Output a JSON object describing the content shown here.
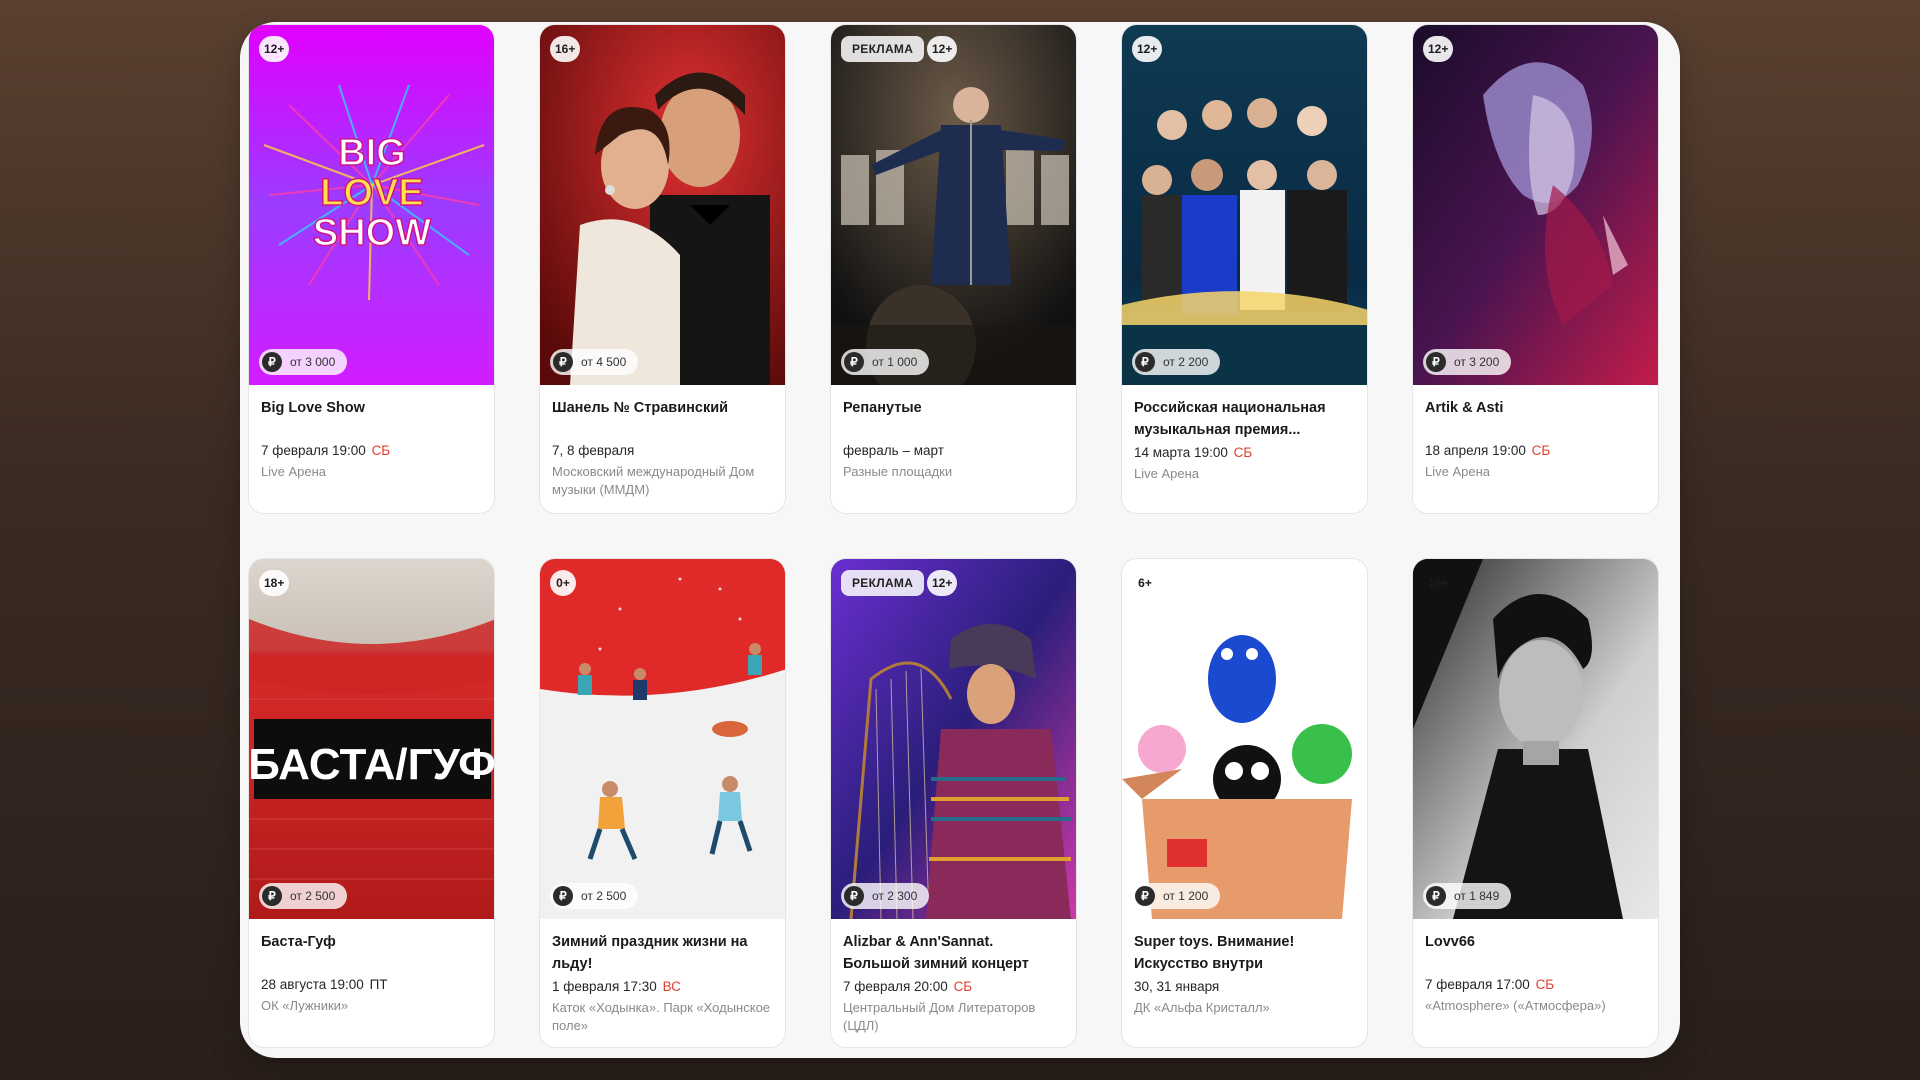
{
  "events": [
    {
      "age": "12+",
      "ad": "",
      "price": "от 3 000",
      "title": "Big Love Show",
      "date": "7 февраля 19:00",
      "dow": "СБ",
      "venue": "Live Арена",
      "poster_icon": "big-love-show-poster",
      "poster_text": [
        "BIG",
        "LOVE",
        "SHOW"
      ]
    },
    {
      "age": "16+",
      "ad": "",
      "price": "от 4 500",
      "title": "Шанель № Стравинский",
      "date": "7, 8 февраля",
      "dow": "",
      "venue": "Московский международный Дом музыки (ММДМ)",
      "poster_icon": "couple-poster"
    },
    {
      "age": "12+",
      "ad": "РЕКЛАМА",
      "price": "от 1 000",
      "title": "Репанутые",
      "date": "февраль – март",
      "dow": "",
      "venue": "Разные площадки",
      "poster_icon": "singer-stage-poster"
    },
    {
      "age": "12+",
      "ad": "",
      "price": "от 2 200",
      "title": "Российская национальная музыкальная премия...",
      "date": "14 марта 19:00",
      "dow": "СБ",
      "venue": "Live Арена",
      "poster_icon": "award-group-poster"
    },
    {
      "age": "12+",
      "ad": "",
      "price": "от 3 200",
      "title": "Artik & Asti",
      "date": "18 апреля 19:00",
      "dow": "СБ",
      "venue": "Live Арена",
      "poster_icon": "artist-portrait-poster"
    },
    {
      "age": "18+",
      "ad": "",
      "price": "от 2 500",
      "title": "Баста-Гуф",
      "date": "28 августа 19:00",
      "dow": "ПТ",
      "venue": "ОК «Лужники»",
      "poster_icon": "stadium-poster",
      "poster_text": [
        "БАСТА/ГУФ"
      ]
    },
    {
      "age": "0+",
      "ad": "",
      "price": "от 2 500",
      "title": "Зимний праздник жизни на льду!",
      "date": "1 февраля 17:30",
      "dow": "ВС",
      "venue": "Каток «Ходынка». Парк «Ходынское поле»",
      "poster_icon": "ice-skaters-poster"
    },
    {
      "age": "12+",
      "ad": "РЕКЛАМА",
      "price": "от 2 300",
      "title": "Alizbar & Ann'Sannat. Большой зимний концерт",
      "date": "7 февраля 20:00",
      "dow": "СБ",
      "venue": "Центральный Дом Литераторов (ЦДЛ)",
      "poster_icon": "harpist-poster"
    },
    {
      "age": "6+",
      "ad": "",
      "price": "от 1 200",
      "title": "Super toys. Внимание! Искусство внутри",
      "date": "30, 31 января",
      "dow": "",
      "venue": "ДК «Альфа Кристалл»",
      "poster_icon": "toys-box-poster"
    },
    {
      "age": "16+",
      "ad": "",
      "price": "от 1 849",
      "title": "Lovv66",
      "date": "7 февраля 17:00",
      "dow": "СБ",
      "venue": "«Atmosphere» («Атмосфера»)",
      "poster_icon": "bw-portrait-poster"
    }
  ],
  "currency_icon": "ruble-icon",
  "currency_symbol": "₽",
  "colors": {
    "weekend": "#e0402c",
    "background": "#f7f7f7"
  }
}
